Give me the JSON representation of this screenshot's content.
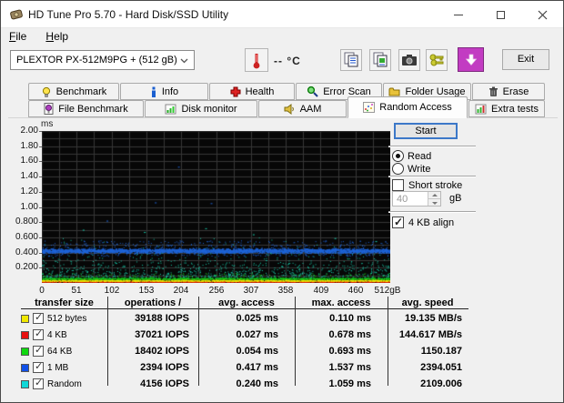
{
  "window": {
    "title": "HD Tune Pro 5.70 - Hard Disk/SSD Utility"
  },
  "menu": {
    "file": "File",
    "help": "Help"
  },
  "toolbar": {
    "drive_selected": "PLEXTOR PX-512M9PG + (512 gB)",
    "temperature": "-- °C",
    "exit_label": "Exit"
  },
  "tabs": {
    "row1": [
      "Benchmark",
      "Info",
      "Health",
      "Error Scan",
      "Folder Usage",
      "Erase"
    ],
    "row2": [
      "File Benchmark",
      "Disk monitor",
      "AAM",
      "Random Access",
      "Extra tests"
    ],
    "active": "Random Access"
  },
  "panel": {
    "start_label": "Start",
    "read_label": "Read",
    "write_label": "Write",
    "read_selected": true,
    "write_selected": false,
    "short_stroke_label": "Short stroke",
    "short_stroke_checked": false,
    "short_stroke_value": "40",
    "short_stroke_unit": "gB",
    "align_label": "4 KB align",
    "align_checked": true
  },
  "chart_data": {
    "type": "scatter",
    "ylabel": "ms",
    "ylim": [
      0,
      2.0
    ],
    "xlim_gb": [
      0,
      512
    ],
    "grid": true,
    "background": "#070707",
    "grid_color": "#373737",
    "y_ticks": [
      "2.00",
      "1.80",
      "1.60",
      "1.40",
      "1.20",
      "1.00",
      "0.800",
      "0.600",
      "0.400",
      "0.200"
    ],
    "x_ticks": [
      "0",
      "51",
      "102",
      "153",
      "204",
      "256",
      "307",
      "358",
      "409",
      "460",
      "512gB"
    ],
    "series": [
      {
        "name": "512 bytes",
        "color": "#f0e800",
        "avg_ms": 0.025,
        "max_ms": 0.11,
        "band_ms": [
          0.024,
          0.04
        ],
        "count": 1500,
        "density": "dense-line"
      },
      {
        "name": "4 KB",
        "color": "#e03010",
        "avg_ms": 0.027,
        "max_ms": 0.678,
        "band_ms": [
          0.012,
          0.024
        ],
        "count": 1400,
        "density": "dense-line"
      },
      {
        "name": "64 KB",
        "color": "#18c818",
        "avg_ms": 0.054,
        "max_ms": 0.693,
        "band_ms": [
          0.046,
          0.068
        ],
        "count": 1600,
        "density": "dense-line",
        "sprinkle": [
          {
            "band_ms": [
              0.07,
              0.13
            ],
            "count": 130
          }
        ]
      },
      {
        "name": "1 MB",
        "color": "#1e64d8",
        "avg_ms": 0.417,
        "max_ms": 1.537,
        "band_ms": [
          0.39,
          0.46
        ],
        "count": 2800,
        "density": "dense-band",
        "sprinkle": [
          {
            "band_ms": [
              0.46,
              0.56
            ],
            "count": 260
          },
          {
            "band_ms": [
              0.355,
              0.39
            ],
            "count": 120
          }
        ],
        "outliers_gb_ms": [
          [
            200,
            1.53
          ],
          [
            166,
            1.06
          ],
          [
            248,
            1.05
          ],
          [
            95,
            0.82
          ]
        ]
      },
      {
        "name": "Random",
        "color": "#17c9a8",
        "avg_ms": 0.24,
        "max_ms": 1.059,
        "band_ms": [
          0.06,
          0.6
        ],
        "count": 950,
        "density": "scatter",
        "outliers_gb_ms": [
          [
            60,
            0.7
          ],
          [
            150,
            0.67
          ],
          [
            240,
            0.72
          ],
          [
            310,
            0.64
          ],
          [
            430,
            0.59
          ],
          [
            490,
            0.55
          ]
        ]
      }
    ]
  },
  "results_table": {
    "headers": [
      "transfer size",
      "operations /",
      "avg. access",
      "max. access",
      "avg. speed"
    ],
    "rows": [
      {
        "color": "#f0e800",
        "checked": true,
        "label": "512 bytes",
        "operations": "39188 IOPS",
        "avg_access": "0.025 ms",
        "max_access": "0.110 ms",
        "avg_speed": "19.135 MB/s"
      },
      {
        "color": "#e81010",
        "checked": true,
        "label": "4 KB",
        "operations": "37021 IOPS",
        "avg_access": "0.027 ms",
        "max_access": "0.678 ms",
        "avg_speed": "144.617 MB/s"
      },
      {
        "color": "#10d810",
        "checked": true,
        "label": "64 KB",
        "operations": "18402 IOPS",
        "avg_access": "0.054 ms",
        "max_access": "0.693 ms",
        "avg_speed": "1150.187"
      },
      {
        "color": "#1050e8",
        "checked": true,
        "label": "1 MB",
        "operations": "2394 IOPS",
        "avg_access": "0.417 ms",
        "max_access": "1.537 ms",
        "avg_speed": "2394.051"
      },
      {
        "color": "#10d8d8",
        "checked": true,
        "label": "Random",
        "operations": "4156 IOPS",
        "avg_access": "0.240 ms",
        "max_access": "1.059 ms",
        "avg_speed": "2109.006"
      }
    ]
  }
}
